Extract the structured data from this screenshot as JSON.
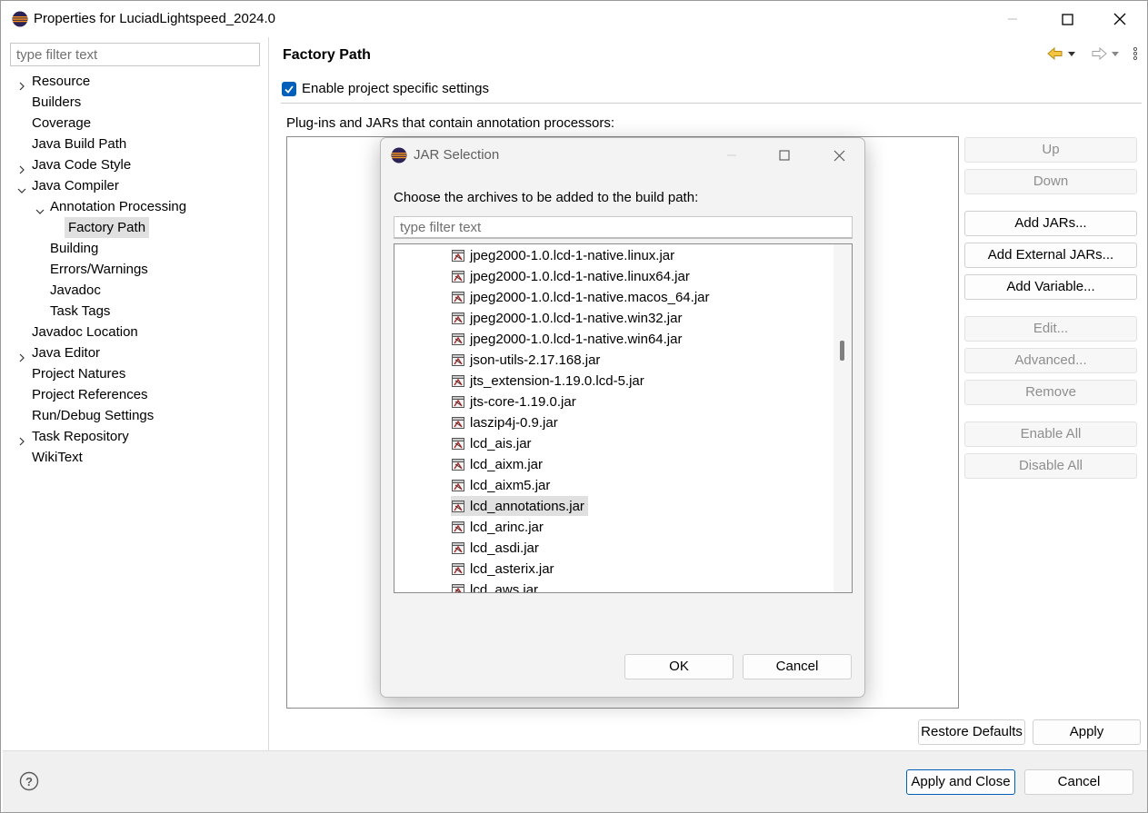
{
  "window": {
    "title": "Properties for LuciadLightspeed_2024.0"
  },
  "left": {
    "filter_placeholder": "type filter text",
    "tree": [
      {
        "label": "Resource",
        "indent": 0,
        "expander": "collapsed"
      },
      {
        "label": "Builders",
        "indent": 0,
        "expander": "none"
      },
      {
        "label": "Coverage",
        "indent": 0,
        "expander": "none"
      },
      {
        "label": "Java Build Path",
        "indent": 0,
        "expander": "none"
      },
      {
        "label": "Java Code Style",
        "indent": 0,
        "expander": "collapsed"
      },
      {
        "label": "Java Compiler",
        "indent": 0,
        "expander": "expanded"
      },
      {
        "label": "Annotation Processing",
        "indent": 1,
        "expander": "expanded"
      },
      {
        "label": "Factory Path",
        "indent": 2,
        "expander": "none",
        "selected": true
      },
      {
        "label": "Building",
        "indent": 1,
        "expander": "none"
      },
      {
        "label": "Errors/Warnings",
        "indent": 1,
        "expander": "none"
      },
      {
        "label": "Javadoc",
        "indent": 1,
        "expander": "none"
      },
      {
        "label": "Task Tags",
        "indent": 1,
        "expander": "none"
      },
      {
        "label": "Javadoc Location",
        "indent": 0,
        "expander": "none"
      },
      {
        "label": "Java Editor",
        "indent": 0,
        "expander": "collapsed"
      },
      {
        "label": "Project Natures",
        "indent": 0,
        "expander": "none"
      },
      {
        "label": "Project References",
        "indent": 0,
        "expander": "none"
      },
      {
        "label": "Run/Debug Settings",
        "indent": 0,
        "expander": "none"
      },
      {
        "label": "Task Repository",
        "indent": 0,
        "expander": "collapsed"
      },
      {
        "label": "WikiText",
        "indent": 0,
        "expander": "none"
      }
    ]
  },
  "page": {
    "header": "Factory Path",
    "enable_label": "Enable project specific settings",
    "enable_checked": true,
    "list_label": "Plug-ins and JARs that contain annotation processors:",
    "buttons": {
      "up": "Up",
      "down": "Down",
      "add_jars": "Add JARs...",
      "add_external": "Add External JARs...",
      "add_variable": "Add Variable...",
      "edit": "Edit...",
      "advanced": "Advanced...",
      "remove": "Remove",
      "enable_all": "Enable All",
      "disable_all": "Disable All"
    },
    "restore_defaults": "Restore Defaults",
    "apply": "Apply"
  },
  "footer": {
    "apply_and_close": "Apply and Close",
    "cancel": "Cancel"
  },
  "dialog": {
    "title": "JAR Selection",
    "prompt": "Choose the archives to be added to the build path:",
    "filter_placeholder": "type filter text",
    "jars": [
      "jpeg2000-1.0.lcd-1-native.linux.jar",
      "jpeg2000-1.0.lcd-1-native.linux64.jar",
      "jpeg2000-1.0.lcd-1-native.macos_64.jar",
      "jpeg2000-1.0.lcd-1-native.win32.jar",
      "jpeg2000-1.0.lcd-1-native.win64.jar",
      "json-utils-2.17.168.jar",
      "jts_extension-1.19.0.lcd-5.jar",
      "jts-core-1.19.0.jar",
      "laszip4j-0.9.jar",
      "lcd_ais.jar",
      "lcd_aixm.jar",
      "lcd_aixm5.jar",
      "lcd_annotations.jar",
      "lcd_arinc.jar",
      "lcd_asdi.jar",
      "lcd_asterix.jar",
      "lcd_aws.jar"
    ],
    "selected_jar": "lcd_annotations.jar",
    "ok": "OK",
    "cancel": "Cancel"
  }
}
